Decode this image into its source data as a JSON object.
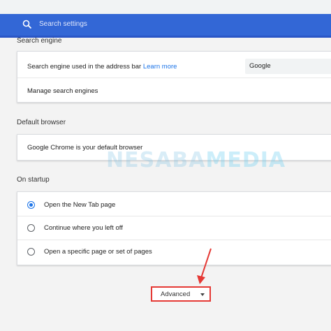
{
  "search": {
    "placeholder": "Search settings"
  },
  "search_engine": {
    "title": "Search engine",
    "address_bar_label": "Search engine used in the address bar",
    "learn_more": "Learn more",
    "selected_engine": "Google",
    "manage_label": "Manage search engines"
  },
  "default_browser": {
    "title": "Default browser",
    "status": "Google Chrome is your default browser"
  },
  "on_startup": {
    "title": "On startup",
    "options": [
      {
        "label": "Open the New Tab page",
        "checked": true
      },
      {
        "label": "Continue where you left off",
        "checked": false
      },
      {
        "label": "Open a specific page or set of pages",
        "checked": false
      }
    ]
  },
  "advanced": {
    "label": "Advanced"
  },
  "watermark": {
    "part1": "NESABA",
    "part2": "MEDIA"
  },
  "colors": {
    "header": "#3367d6",
    "accent": "#1a73e8",
    "highlight": "#e53935"
  }
}
